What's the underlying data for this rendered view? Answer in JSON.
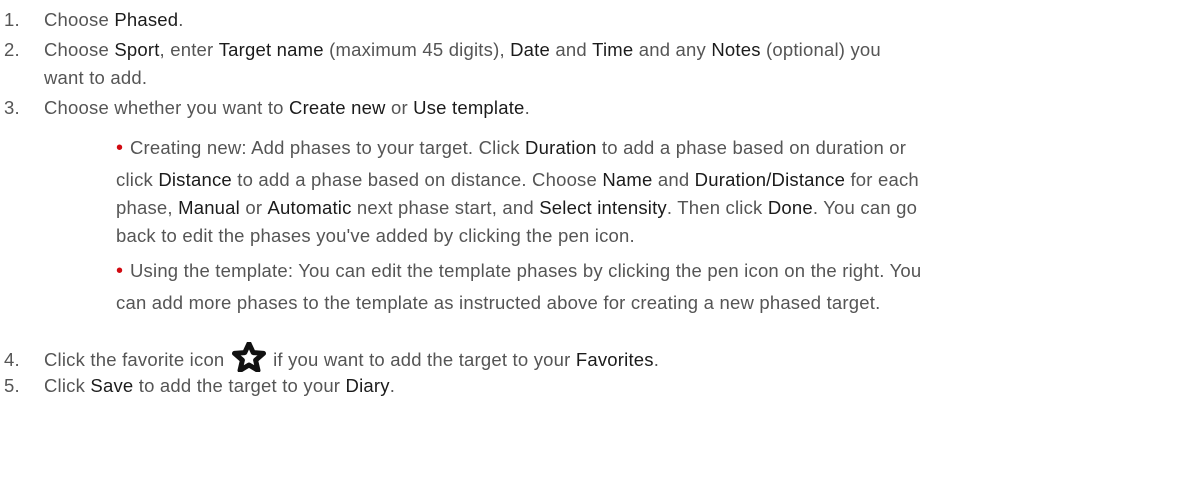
{
  "steps": [
    {
      "number": "1.",
      "text": "Choose ",
      "bold1": "Phased",
      "end": "."
    },
    {
      "number": "2.",
      "t1": "Choose ",
      "b1": "Sport",
      "t2": ", enter ",
      "b2": "Target name",
      "t3": " (maximum 45 digits), ",
      "b3": "Date",
      "t4": " and ",
      "b4": "Time",
      "t5": " and any ",
      "b5": "Notes",
      "t6": " (optional) you",
      "t7": "want to add."
    },
    {
      "number": "3.",
      "t1": "Choose whether you want to ",
      "b1": "Create new",
      "t2": " or ",
      "b2": "Use template",
      "t3": "."
    },
    {
      "number": "4.",
      "t1": "Click the favorite icon ",
      "t2": " if you want to add the target to your ",
      "b1": "Favorites",
      "t3": "."
    },
    {
      "number": "5.",
      "t1": "Click ",
      "b1": "Save",
      "t2": " to add the target to your ",
      "b2": "Diary",
      "t3": "."
    }
  ],
  "bullets": {
    "symbol": "•",
    "creating": {
      "l1a": "Creating new: Add phases to your target. Click ",
      "l1b": "Duration",
      "l1c": " to add a phase based on duration or",
      "l2a": "click ",
      "l2b": "Distance",
      "l2c": " to add a phase based on distance. Choose ",
      "l2d": "Name",
      "l2e": " and ",
      "l2f": "Duration/Distance",
      "l2g": " for each",
      "l3a": "phase, ",
      "l3b": "Manual",
      "l3c": " or ",
      "l3d": "Automatic",
      "l3e": " next phase start, and ",
      "l3f": "Select intensity",
      "l3g": ". Then click ",
      "l3h": "Done",
      "l3i": ". You can go",
      "l4": "back to edit the phases you've added by clicking the pen icon."
    },
    "template": {
      "l1": "Using the template: You can edit the template phases by clicking the pen icon on the right. You",
      "l2": "can add more phases to the template as instructed above for creating a new phased target."
    }
  },
  "colors": {
    "bullet": "#d10a11",
    "keyword": "#1b1b1b",
    "body_text": "#555555"
  },
  "icons": {
    "favorite": "star-outline-icon"
  }
}
